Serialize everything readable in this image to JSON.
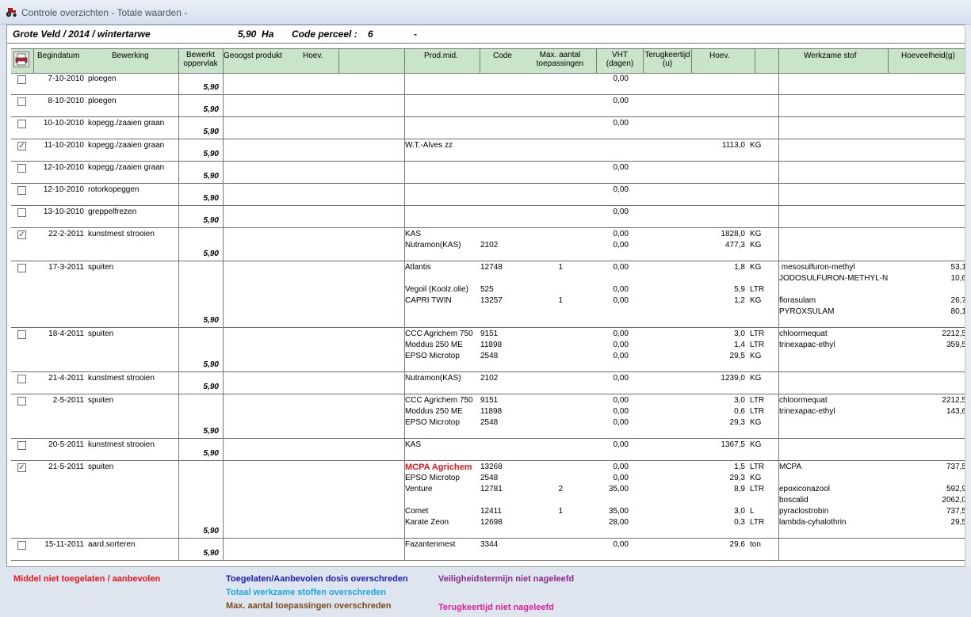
{
  "window": {
    "title": "Controle overzichten - Totale waarden -"
  },
  "header": {
    "field": "Grote Veld / 2014 / wintertarwe",
    "area": "5,90  Ha",
    "code_label": "Code perceel :",
    "code_value": "6",
    "dash": "-"
  },
  "columns": {
    "begindatum": "Begindatum",
    "bewerking": "Bewerking",
    "bewerkt_1": "Bewerkt",
    "bewerkt_2": "oppervlak",
    "geoogst": "Geoogst produkt",
    "hoev1": "Hoev.",
    "prodmid": "Prod.mid.",
    "code": "Code",
    "max_1": "Max. aantal",
    "max_2": "toepassingen",
    "vht_1": "VHT",
    "vht_2": "(dagen)",
    "terug_1": "Terugkeertijd",
    "terug_2": "(u)",
    "hoev2": "Hoev.",
    "werkzaam": "Werkzame stof",
    "hoeveelheid": "Hoeveelheid(g)"
  },
  "rows": [
    {
      "checked": false,
      "date": "7-10-2010",
      "op": "ploegen",
      "opp": "5,90",
      "lines": [
        {
          "vht": "0,00"
        }
      ],
      "subs": []
    },
    {
      "checked": false,
      "date": "8-10-2010",
      "op": "ploegen",
      "opp": "5,90",
      "lines": [
        {
          "vht": "0,00"
        }
      ],
      "subs": []
    },
    {
      "checked": false,
      "date": "10-10-2010",
      "op": "kopegg./zaaien graan",
      "opp": "5,90",
      "lines": [
        {
          "vht": "0,00"
        }
      ],
      "subs": []
    },
    {
      "checked": true,
      "date": "11-10-2010",
      "op": "kopegg./zaaien graan",
      "opp": "5,90",
      "lines": [
        {
          "prod": "W.T.-Alves zz",
          "hoev": "1113,0",
          "unit": "KG"
        }
      ],
      "subs": []
    },
    {
      "checked": false,
      "date": "12-10-2010",
      "op": "kopegg./zaaien graan",
      "opp": "5,90",
      "lines": [
        {
          "vht": "0,00"
        }
      ],
      "subs": []
    },
    {
      "checked": false,
      "date": "12-10-2010",
      "op": "rotorkopeggen",
      "opp": "5,90",
      "lines": [
        {
          "vht": "0,00"
        }
      ],
      "subs": []
    },
    {
      "checked": false,
      "date": "13-10-2010",
      "op": "greppelfrezen",
      "opp": "5,90",
      "lines": [
        {
          "vht": "0,00"
        }
      ],
      "subs": []
    },
    {
      "checked": true,
      "date": "22-2-2011",
      "op": "kunstmest strooien",
      "opp": "5,90",
      "lines": [
        {
          "prod": "KAS",
          "vht": "0,00",
          "hoev": "1828,0",
          "unit": "KG"
        },
        {
          "prod": "Nutramon(KAS)",
          "code": "2102",
          "vht": "0,00",
          "hoev": "477,3",
          "unit": "KG"
        }
      ],
      "subs": []
    },
    {
      "checked": false,
      "date": "17-3-2011",
      "op": "spuiten",
      "opp": "5,90",
      "lines": [
        {
          "prod": "Atlantis",
          "code": "12748",
          "max": "1",
          "vht": "0,00",
          "hoev": "1,8",
          "unit": "KG"
        },
        {},
        {
          "prod": "Vegoil (Koolz.olie)",
          "code": "525",
          "vht": "0,00",
          "hoev": "5,9",
          "unit": "LTR"
        },
        {
          "prod": "CAPRI TWIN",
          "code": "13257",
          "max": "1",
          "vht": "0,00",
          "hoev": "1,2",
          "unit": "KG"
        }
      ],
      "subs": [
        {
          "name": " mesosulfuron-methyl",
          "val": "53,1"
        },
        {
          "name": "JODOSULFURON-METHYL-N",
          "val": "10,6"
        },
        {},
        {
          "name": "florasulam",
          "val": "26,7"
        },
        {
          "name": "PYROXSULAM",
          "val": "80,1"
        }
      ]
    },
    {
      "checked": false,
      "date": "18-4-2011",
      "op": "spuiten",
      "opp": "5,90",
      "lines": [
        {
          "prod": "CCC Agrichem 750",
          "code": "9151",
          "vht": "0,00",
          "hoev": "3,0",
          "unit": "LTR"
        },
        {
          "prod": "Moddus 250 ME",
          "code": "11898",
          "vht": "0,00",
          "hoev": "1,4",
          "unit": "LTR"
        },
        {
          "prod": "EPSO Microtop",
          "code": "2548",
          "vht": "0,00",
          "hoev": "29,5",
          "unit": "KG"
        }
      ],
      "subs": [
        {
          "name": "chloormequat",
          "val": "2212,5"
        },
        {
          "name": "trinexapac-ethyl",
          "val": "359,5"
        }
      ]
    },
    {
      "checked": false,
      "date": "21-4-2011",
      "op": "kunstmest strooien",
      "opp": "5,90",
      "lines": [
        {
          "prod": "Nutramon(KAS)",
          "code": "2102",
          "vht": "0,00",
          "hoev": "1239,0",
          "unit": "KG"
        }
      ],
      "subs": []
    },
    {
      "checked": false,
      "date": "2-5-2011",
      "op": "spuiten",
      "opp": "5,90",
      "lines": [
        {
          "prod": "CCC Agrichem 750",
          "code": "9151",
          "vht": "0,00",
          "hoev": "3,0",
          "unit": "LTR"
        },
        {
          "prod": "Moddus 250 ME",
          "code": "11898",
          "vht": "0,00",
          "hoev": "0,6",
          "unit": "LTR"
        },
        {
          "prod": "EPSO Microtop",
          "code": "2548",
          "vht": "0,00",
          "hoev": "29,3",
          "unit": "KG"
        }
      ],
      "subs": [
        {
          "name": "chloormequat",
          "val": "2212,5"
        },
        {
          "name": "trinexapac-ethyl",
          "val": "143,6"
        }
      ]
    },
    {
      "checked": false,
      "date": "20-5-2011",
      "op": "kunstmest strooien",
      "opp": "5,90",
      "lines": [
        {
          "prod": "KAS",
          "vht": "0,00",
          "hoev": "1367,5",
          "unit": "KG"
        }
      ],
      "subs": []
    },
    {
      "checked": true,
      "date": "21-5-2011",
      "op": "spuiten",
      "opp": "5,90",
      "lines": [
        {
          "prod": "MCPA Agrichem",
          "red": true,
          "code": "13268",
          "vht": "0,00",
          "hoev": "1,5",
          "unit": "LTR"
        },
        {
          "prod": "EPSO Microtop",
          "code": "2548",
          "vht": "0,00",
          "hoev": "29,3",
          "unit": "KG"
        },
        {
          "prod": "Venture",
          "code": "12781",
          "max": "2",
          "vht": "35,00",
          "hoev": "8,9",
          "unit": "LTR"
        },
        {},
        {
          "prod": "Comet",
          "code": "12411",
          "max": "1",
          "vht": "35,00",
          "hoev": "3,0",
          "unit": "L"
        },
        {
          "prod": "Karate Zeon",
          "code": "12698",
          "vht": "28,00",
          "hoev": "0,3",
          "unit": "LTR"
        }
      ],
      "subs": [
        {
          "name": "MCPA",
          "val": "737,5"
        },
        {},
        {
          "name": "epoxiconazool",
          "val": "592,9"
        },
        {
          "name": "boscalid",
          "val": "2062,0"
        },
        {
          "name": "pyraclostrobin",
          "val": "737,5"
        },
        {
          "name": "lambda-cyhalothrin",
          "val": "29,5"
        }
      ]
    },
    {
      "checked": false,
      "date": "15-11-2011",
      "op": "aard.sorteren",
      "opp": "5,90",
      "lines": [
        {
          "prod": "Fazantenmest",
          "code": "3344",
          "vht": "0,00",
          "hoev": "29,6",
          "unit": "ton"
        }
      ],
      "subs": []
    }
  ],
  "legend": {
    "red": {
      "text": "Middel niet toegelaten / aanbevolen",
      "color": "#e8141c"
    },
    "blue": {
      "text": "Toegelaten/Aanbevolen dosis overschreden",
      "color": "#1c1cb4"
    },
    "cyan": {
      "text": "Totaal werkzame stoffen overschreden",
      "color": "#19a8e6"
    },
    "brown": {
      "text": "Max. aantal toepassingen overschreden",
      "color": "#7a4a1a"
    },
    "purple": {
      "text": "Veiligheidstermijn niet nageleefd",
      "color": "#8a2a8a"
    },
    "pink": {
      "text": "Terugkeertijd niet nageleefd",
      "color": "#e0209a"
    }
  }
}
